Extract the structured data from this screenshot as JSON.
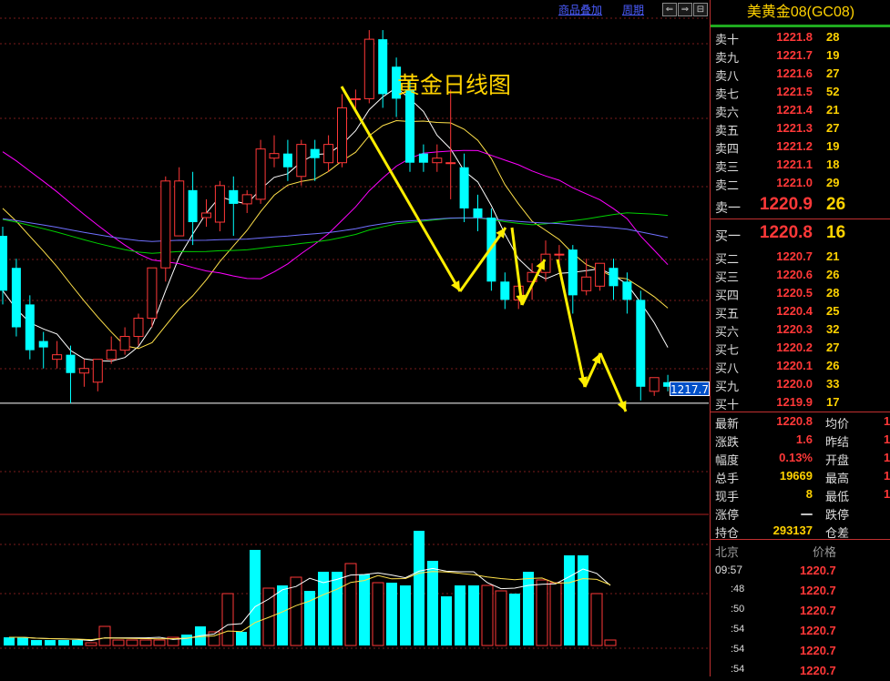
{
  "toolbar": {
    "overlay_label": "商品叠加",
    "period_label": "周期",
    "nav_left": "⇐",
    "nav_right": "⇒",
    "nav_end": "⊟"
  },
  "chart": {
    "title": "黄金日线图",
    "price_tag": "1217.7"
  },
  "instrument": {
    "title": "美黄金08(GC08)"
  },
  "order_book": {
    "asks": [
      {
        "label": "卖十",
        "price": "1221.8",
        "volume": "28"
      },
      {
        "label": "卖九",
        "price": "1221.7",
        "volume": "19"
      },
      {
        "label": "卖八",
        "price": "1221.6",
        "volume": "27"
      },
      {
        "label": "卖七",
        "price": "1221.5",
        "volume": "52"
      },
      {
        "label": "卖六",
        "price": "1221.4",
        "volume": "21"
      },
      {
        "label": "卖五",
        "price": "1221.3",
        "volume": "27"
      },
      {
        "label": "卖四",
        "price": "1221.2",
        "volume": "19"
      },
      {
        "label": "卖三",
        "price": "1221.1",
        "volume": "18"
      },
      {
        "label": "卖二",
        "price": "1221.0",
        "volume": "29"
      },
      {
        "label": "卖一",
        "price": "1220.9",
        "volume": "26"
      }
    ],
    "bids": [
      {
        "label": "买一",
        "price": "1220.8",
        "volume": "16"
      },
      {
        "label": "买二",
        "price": "1220.7",
        "volume": "21"
      },
      {
        "label": "买三",
        "price": "1220.6",
        "volume": "26"
      },
      {
        "label": "买四",
        "price": "1220.5",
        "volume": "28"
      },
      {
        "label": "买五",
        "price": "1220.4",
        "volume": "25"
      },
      {
        "label": "买六",
        "price": "1220.3",
        "volume": "32"
      },
      {
        "label": "买七",
        "price": "1220.2",
        "volume": "27"
      },
      {
        "label": "买八",
        "price": "1220.1",
        "volume": "26"
      },
      {
        "label": "买九",
        "price": "1220.0",
        "volume": "33"
      },
      {
        "label": "买十",
        "price": "1219.9",
        "volume": "17"
      }
    ]
  },
  "stats": [
    {
      "l1": "最新",
      "v1": "1220.8",
      "c1": "red",
      "l2": "均价",
      "v2": "1"
    },
    {
      "l1": "涨跌",
      "v1": "1.6",
      "c1": "red",
      "l2": "昨结",
      "v2": "1"
    },
    {
      "l1": "幅度",
      "v1": "0.13%",
      "c1": "red",
      "l2": "开盘",
      "v2": "1"
    },
    {
      "l1": "总手",
      "v1": "19669",
      "c1": "yel",
      "l2": "最高",
      "v2": "1"
    },
    {
      "l1": "现手",
      "v1": "8",
      "c1": "yel",
      "l2": "最低",
      "v2": "1"
    },
    {
      "l1": "涨停",
      "v1": "一",
      "c1": "wht",
      "l2": "跌停",
      "v2": ""
    },
    {
      "l1": "持仓",
      "v1": "293137",
      "c1": "yel",
      "l2": "仓差",
      "v2": ""
    }
  ],
  "ticks": {
    "header_time": "北京",
    "header_price": "价格",
    "rows": [
      {
        "time": "09:57",
        "price": "1220.7"
      },
      {
        "time": ":48",
        "price": "1220.7"
      },
      {
        "time": ":50",
        "price": "1220.7"
      },
      {
        "time": ":54",
        "price": "1220.7"
      },
      {
        "time": ":54",
        "price": "1220.7"
      },
      {
        "time": ":54",
        "price": "1220.7"
      }
    ]
  },
  "colors": {
    "up": "#ff3838",
    "down": "#00ffff",
    "arrow": "#ffee00",
    "ma5": "#ffffff",
    "ma10": "#ffe14a",
    "ma20": "#ff00ff",
    "ma40": "#00d000",
    "ma60": "#7070ff"
  },
  "chart_data": {
    "type": "candlestick",
    "candles": [
      {
        "o": 1236.0,
        "h": 1237.0,
        "c": 1230.0,
        "l": 1228.5
      },
      {
        "o": 1232.5,
        "h": 1233.5,
        "c": 1226.0,
        "l": 1225.0
      },
      {
        "o": 1228.5,
        "h": 1229.5,
        "c": 1223.5,
        "l": 1222.5
      },
      {
        "o": 1224.5,
        "h": 1225.5,
        "c": 1223.8,
        "l": 1221.5
      },
      {
        "o": 1222.5,
        "h": 1224.5,
        "c": 1223.0,
        "l": 1221.5
      },
      {
        "o": 1223.0,
        "h": 1224.0,
        "c": 1221.0,
        "l": 1217.7
      },
      {
        "o": 1221.0,
        "h": 1222.5,
        "c": 1221.5,
        "l": 1219.5
      },
      {
        "o": 1220.0,
        "h": 1222.5,
        "c": 1222.5,
        "l": 1219.0
      },
      {
        "o": 1222.5,
        "h": 1225.0,
        "c": 1223.5,
        "l": 1222.0
      },
      {
        "o": 1223.5,
        "h": 1226.0,
        "c": 1225.0,
        "l": 1223.0
      },
      {
        "o": 1225.0,
        "h": 1227.5,
        "c": 1227.0,
        "l": 1224.0
      },
      {
        "o": 1227.0,
        "h": 1232.5,
        "c": 1232.5,
        "l": 1226.0
      },
      {
        "o": 1232.5,
        "h": 1242.5,
        "c": 1242.0,
        "l": 1231.0
      },
      {
        "o": 1236.0,
        "h": 1243.5,
        "c": 1242.0,
        "l": 1236.0
      },
      {
        "o": 1241.0,
        "h": 1243.0,
        "c": 1237.5,
        "l": 1235.0
      },
      {
        "o": 1238.0,
        "h": 1240.0,
        "c": 1238.5,
        "l": 1237.0
      },
      {
        "o": 1237.5,
        "h": 1242.0,
        "c": 1241.5,
        "l": 1236.5
      },
      {
        "o": 1241.0,
        "h": 1242.5,
        "c": 1239.5,
        "l": 1236.0
      },
      {
        "o": 1239.5,
        "h": 1241.0,
        "c": 1240.5,
        "l": 1238.5
      },
      {
        "o": 1240.0,
        "h": 1246.5,
        "c": 1245.5,
        "l": 1239.5
      },
      {
        "o": 1244.5,
        "h": 1247.0,
        "c": 1245.0,
        "l": 1243.5
      },
      {
        "o": 1245.0,
        "h": 1246.5,
        "c": 1243.5,
        "l": 1242.0
      },
      {
        "o": 1242.5,
        "h": 1246.5,
        "c": 1246.0,
        "l": 1241.5
      },
      {
        "o": 1245.5,
        "h": 1246.5,
        "c": 1244.5,
        "l": 1242.0
      },
      {
        "o": 1244.0,
        "h": 1247.0,
        "c": 1246.0,
        "l": 1243.0
      },
      {
        "o": 1244.0,
        "h": 1251.5,
        "c": 1250.0,
        "l": 1243.5
      },
      {
        "o": 1251.0,
        "h": 1252.0,
        "c": 1251.0,
        "l": 1249.5
      },
      {
        "o": 1251.0,
        "h": 1258.5,
        "c": 1257.5,
        "l": 1250.5
      },
      {
        "o": 1257.5,
        "h": 1258.5,
        "c": 1251.5,
        "l": 1250.0
      },
      {
        "o": 1254.5,
        "h": 1255.5,
        "c": 1251.0,
        "l": 1249.0
      },
      {
        "o": 1252.0,
        "h": 1253.0,
        "c": 1244.0,
        "l": 1243.0
      },
      {
        "o": 1245.0,
        "h": 1246.0,
        "c": 1244.0,
        "l": 1243.0
      },
      {
        "o": 1244.0,
        "h": 1246.0,
        "c": 1244.5,
        "l": 1243.0
      },
      {
        "o": 1244.0,
        "h": 1252.0,
        "c": 1244.0,
        "l": 1240.0
      },
      {
        "o": 1243.5,
        "h": 1245.0,
        "c": 1239.0,
        "l": 1237.5
      },
      {
        "o": 1239.0,
        "h": 1240.5,
        "c": 1238.0,
        "l": 1236.5
      },
      {
        "o": 1238.0,
        "h": 1239.0,
        "c": 1231.0,
        "l": 1230.0
      },
      {
        "o": 1231.0,
        "h": 1232.0,
        "c": 1229.0,
        "l": 1228.0
      },
      {
        "o": 1229.0,
        "h": 1231.5,
        "c": 1230.5,
        "l": 1228.0
      },
      {
        "o": 1231.0,
        "h": 1233.0,
        "c": 1232.0,
        "l": 1229.0
      },
      {
        "o": 1232.0,
        "h": 1235.5,
        "c": 1234.0,
        "l": 1231.0
      },
      {
        "o": 1234.0,
        "h": 1235.0,
        "c": 1234.0,
        "l": 1233.0
      },
      {
        "o": 1234.5,
        "h": 1235.0,
        "c": 1229.5,
        "l": 1227.5
      },
      {
        "o": 1230.0,
        "h": 1233.5,
        "c": 1231.5,
        "l": 1229.5
      },
      {
        "o": 1230.5,
        "h": 1233.0,
        "c": 1233.0,
        "l": 1230.0
      },
      {
        "o": 1232.5,
        "h": 1233.5,
        "c": 1230.5,
        "l": 1229.0
      },
      {
        "o": 1231.0,
        "h": 1232.0,
        "c": 1229.0,
        "l": 1227.5
      },
      {
        "o": 1229.0,
        "h": 1230.0,
        "c": 1219.5,
        "l": 1218.0
      },
      {
        "o": 1219.0,
        "h": 1220.5,
        "c": 1220.5,
        "l": 1218.5
      },
      {
        "o": 1220.0,
        "h": 1220.8,
        "c": 1219.5,
        "l": 1219.0
      }
    ],
    "volume_series": [
      {
        "v": 3,
        "up": false
      },
      {
        "v": 3,
        "up": false
      },
      {
        "v": 2,
        "up": false
      },
      {
        "v": 2,
        "up": false
      },
      {
        "v": 2,
        "up": false
      },
      {
        "v": 2,
        "up": false
      },
      {
        "v": 1,
        "up": true
      },
      {
        "v": 7,
        "up": true
      },
      {
        "v": 2,
        "up": true
      },
      {
        "v": 2,
        "up": true
      },
      {
        "v": 2,
        "up": true
      },
      {
        "v": 2,
        "up": true
      },
      {
        "v": 3,
        "up": true
      },
      {
        "v": 4,
        "up": false
      },
      {
        "v": 7,
        "up": false
      },
      {
        "v": 5,
        "up": true
      },
      {
        "v": 19,
        "up": true
      },
      {
        "v": 5,
        "up": false
      },
      {
        "v": 35,
        "up": false
      },
      {
        "v": 21,
        "up": true
      },
      {
        "v": 22,
        "up": false
      },
      {
        "v": 25,
        "up": true
      },
      {
        "v": 20,
        "up": false
      },
      {
        "v": 27,
        "up": false
      },
      {
        "v": 27,
        "up": false
      },
      {
        "v": 30,
        "up": true
      },
      {
        "v": 26,
        "up": false
      },
      {
        "v": 23,
        "up": true
      },
      {
        "v": 23,
        "up": false
      },
      {
        "v": 22,
        "up": false
      },
      {
        "v": 42,
        "up": false
      },
      {
        "v": 31,
        "up": false
      },
      {
        "v": 18,
        "up": false
      },
      {
        "v": 22,
        "up": false
      },
      {
        "v": 22,
        "up": false
      },
      {
        "v": 22,
        "up": true
      },
      {
        "v": 20,
        "up": true
      },
      {
        "v": 19,
        "up": false
      },
      {
        "v": 27,
        "up": false
      },
      {
        "v": 24,
        "up": true
      },
      {
        "v": 23,
        "up": true
      },
      {
        "v": 33,
        "up": false
      },
      {
        "v": 33,
        "up": false
      },
      {
        "v": 19,
        "up": true
      },
      {
        "v": 2,
        "up": true
      }
    ],
    "price_axis": [
      1215.0,
      1260.0
    ],
    "horizontal_line": 1217.7
  }
}
